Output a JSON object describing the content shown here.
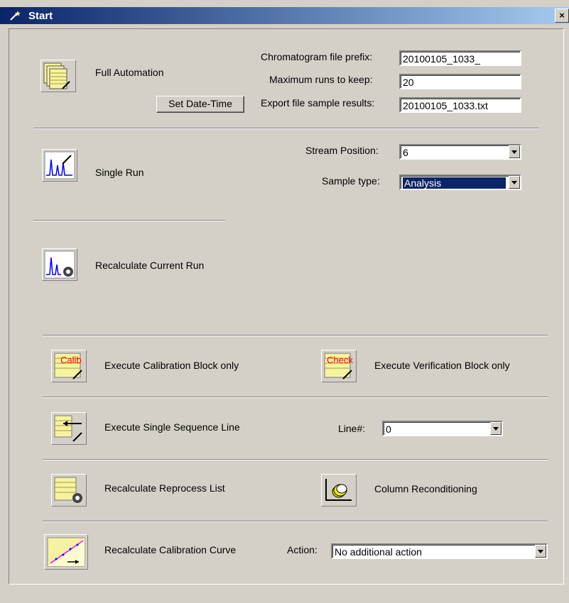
{
  "window": {
    "title": "Start",
    "close_glyph": "×"
  },
  "full_automation": {
    "label": "Full Automation",
    "set_datetime_button": "Set Date-Time",
    "chromatogram_prefix_label": "Chromatogram file prefix:",
    "chromatogram_prefix_value": "20100105_1033_",
    "max_runs_label": "Maximum runs to keep:",
    "max_runs_value": "20",
    "export_label": "Export file sample results:",
    "export_value": "20100105_1033.txt"
  },
  "single_run": {
    "label": "Single Run",
    "stream_position_label": "Stream Position:",
    "stream_position_value": "6",
    "sample_type_label": "Sample type:",
    "sample_type_value": "Analysis"
  },
  "recalculate_current": {
    "label": "Recalculate Current Run"
  },
  "calibration_block": {
    "label": "Execute Calibration Block only",
    "icon_text": "Calib"
  },
  "verification_block": {
    "label": "Execute Verification Block only",
    "icon_text": "Check"
  },
  "single_sequence": {
    "label": "Execute Single Sequence Line",
    "line_label": "Line#:",
    "line_value": "0"
  },
  "reprocess_list": {
    "label": "Recalculate Reprocess List"
  },
  "column_reconditioning": {
    "label": "Column Reconditioning"
  },
  "calibration_curve": {
    "label": "Recalculate Calibration Curve",
    "action_label": "Action:",
    "action_value": "No additional action"
  },
  "icons": [
    "wand-icon",
    "chromatogram-icon",
    "gear-icon",
    "arrow-left-icon",
    "column-coil-icon",
    "calibration-plot-icon"
  ]
}
